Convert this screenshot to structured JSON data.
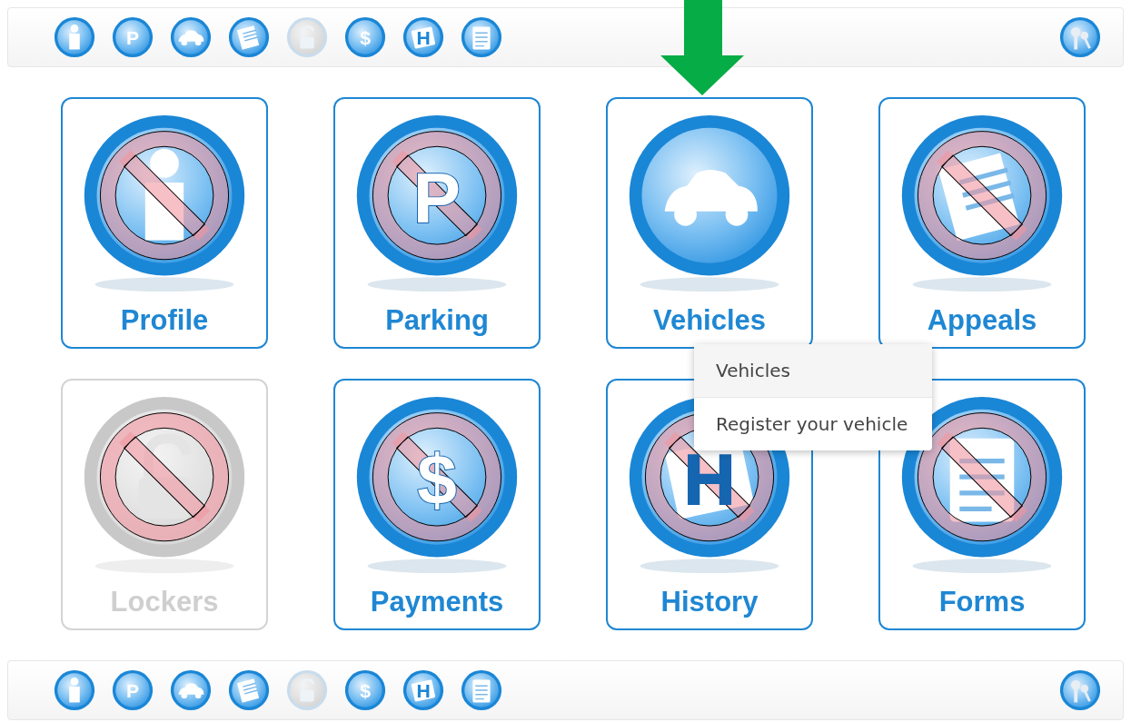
{
  "top_toolbar": {
    "items": [
      {
        "kind": "profile",
        "disabled": false
      },
      {
        "kind": "parking",
        "glyph": "P",
        "disabled": false
      },
      {
        "kind": "vehicle",
        "disabled": false
      },
      {
        "kind": "appeals",
        "disabled": false
      },
      {
        "kind": "lock",
        "disabled": true
      },
      {
        "kind": "payments",
        "glyph": "$",
        "disabled": false
      },
      {
        "kind": "history",
        "glyph": "H",
        "disabled": false
      },
      {
        "kind": "forms",
        "disabled": false
      }
    ]
  },
  "tiles": [
    {
      "label": "Profile",
      "kind": "profile",
      "blocked": true,
      "disabled": false
    },
    {
      "label": "Parking",
      "kind": "parking",
      "glyph": "P",
      "blocked": true,
      "disabled": false
    },
    {
      "label": "Vehicles",
      "kind": "vehicle",
      "blocked": false,
      "disabled": false,
      "pointed": true,
      "menu": [
        {
          "label": "Vehicles"
        },
        {
          "label": "Register your vehicle"
        }
      ]
    },
    {
      "label": "Appeals",
      "kind": "appeals",
      "blocked": true,
      "disabled": false
    },
    {
      "label": "Lockers",
      "kind": "lock",
      "blocked": true,
      "disabled": true
    },
    {
      "label": "Payments",
      "kind": "payments",
      "glyph": "$",
      "blocked": true,
      "disabled": false
    },
    {
      "label": "History",
      "kind": "history",
      "glyph": "H",
      "blocked": true,
      "disabled": false
    },
    {
      "label": "Forms",
      "kind": "forms",
      "blocked": true,
      "disabled": false
    }
  ],
  "bottom_toolbar": {
    "items": [
      {
        "kind": "profile",
        "disabled": false
      },
      {
        "kind": "parking",
        "glyph": "P",
        "disabled": false
      },
      {
        "kind": "vehicle",
        "disabled": false
      },
      {
        "kind": "appeals",
        "disabled": false
      },
      {
        "kind": "lock",
        "disabled": true
      },
      {
        "kind": "payments",
        "glyph": "$",
        "disabled": false
      },
      {
        "kind": "history",
        "glyph": "H",
        "disabled": false
      },
      {
        "kind": "forms",
        "disabled": false
      }
    ]
  }
}
